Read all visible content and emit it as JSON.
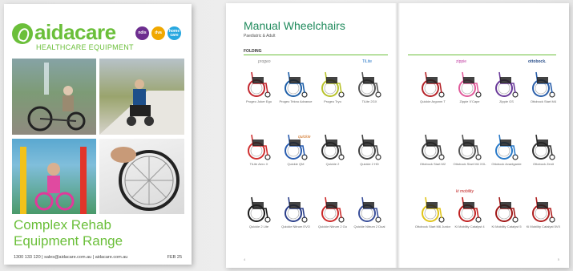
{
  "cover": {
    "brand": "aidacare",
    "tagline": "HEALTHCARE EQUIPMENT",
    "badges": [
      "ndis",
      "dva",
      "home care"
    ],
    "title_line1": "Complex Rehab",
    "title_line2": "Equipment Range",
    "footer": "1300 133 120  |  sales@aidacare.com.au  |  aidacare.com.au",
    "date": "FEB 25"
  },
  "left_page": {
    "title": "Manual Wheelchairs",
    "subtitle": "Paediatric & Adult",
    "section": "FOLDING",
    "brand_a": "progeo",
    "brand_b": "TiLite",
    "brand_c": "quickie",
    "page": "4",
    "rows": [
      [
        {
          "name": "Progeo Joker Ego",
          "color": "#c2262e"
        },
        {
          "name": "Progeo Tekno Advance",
          "color": "#1e5fa8"
        },
        {
          "name": "Progeo Tryo",
          "color": "#b8c22a"
        },
        {
          "name": "TiLite 2GX",
          "color": "#555555"
        }
      ],
      [
        {
          "name": "TiLite Aero X",
          "color": "#d03030"
        },
        {
          "name": "Quickie QM",
          "color": "#2a5db0"
        },
        {
          "name": "Quickie 2",
          "color": "#333333"
        },
        {
          "name": "Quickie 2 HD",
          "color": "#444444"
        }
      ],
      [
        {
          "name": "Quickie 2 Lite",
          "color": "#1a1a1a"
        },
        {
          "name": "Quickie Nitrum EVO",
          "color": "#2b3f8a"
        },
        {
          "name": "Quickie Nitrum 2 Go",
          "color": "#cc2a2a"
        },
        {
          "name": "Quickie Nitrum 2 Dual",
          "color": "#3a4f9a"
        }
      ]
    ]
  },
  "right_page": {
    "brand_a": "zippie",
    "brand_b": "ottobock.",
    "brand_c": "ki mobility",
    "page": "5",
    "rows": [
      [
        {
          "name": "Quickie Argonm T",
          "color": "#b52228"
        },
        {
          "name": "Zippie X'Cape",
          "color": "#e05a9a"
        },
        {
          "name": "Zippie GS",
          "color": "#6a3a9a"
        },
        {
          "name": "Ottobock Start M4",
          "color": "#2a5faa"
        }
      ],
      [
        {
          "name": "Ottobock Start M2",
          "color": "#444444"
        },
        {
          "name": "Ottobock Start M4 XXL",
          "color": "#555555"
        },
        {
          "name": "Ottobock Avantgarde",
          "color": "#2a7ac8"
        },
        {
          "name": "Ottobock Zenit",
          "color": "#333333"
        }
      ],
      [
        {
          "name": "Ottobock Start M6 Junior",
          "color": "#e0c41a"
        },
        {
          "name": "Ki Mobility Catalyst 4",
          "color": "#c02020"
        },
        {
          "name": "Ki Mobility Catalyst 5",
          "color": "#a01818"
        },
        {
          "name": "Ki Mobility Catalyst 5VX",
          "color": "#b02020"
        }
      ]
    ]
  }
}
